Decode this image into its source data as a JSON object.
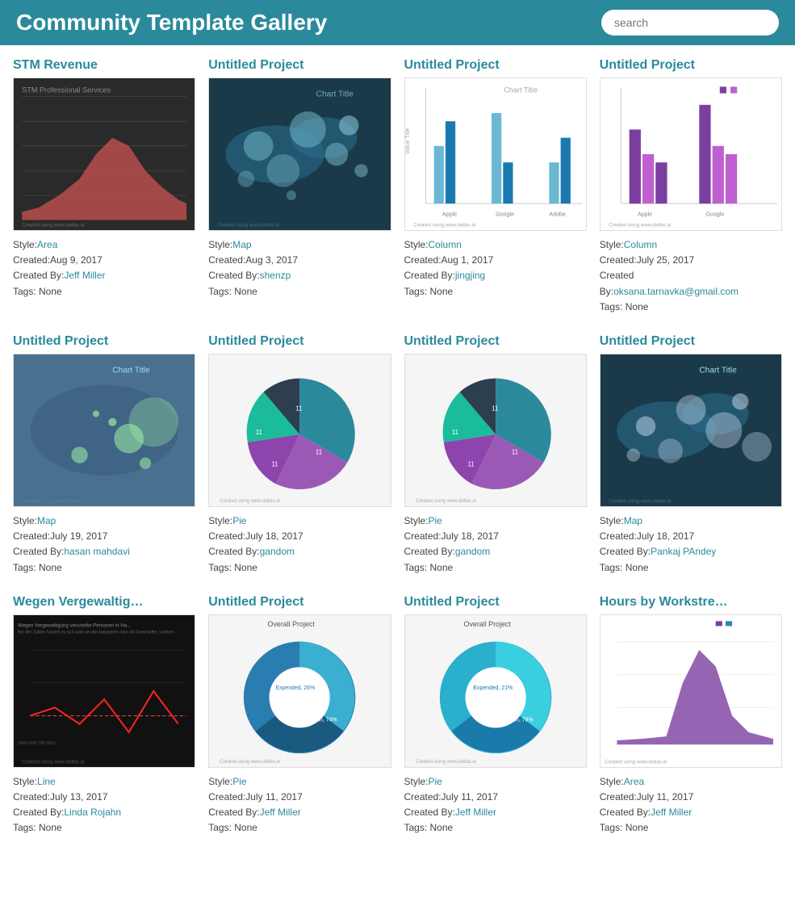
{
  "header": {
    "title": "Community Template Gallery",
    "search_placeholder": "search"
  },
  "cards": [
    {
      "id": "stm-revenue",
      "title": "STM Revenue",
      "style": "Area",
      "created": "Aug 9, 2017",
      "created_by": "Jeff Miller",
      "tags": "None",
      "thumb_type": "area_dark"
    },
    {
      "id": "untitled-1",
      "title": "Untitled Project",
      "style": "Map",
      "created": "Aug 3, 2017",
      "created_by": "shenzp",
      "tags": "None",
      "thumb_type": "map_dark_bubbles"
    },
    {
      "id": "untitled-2",
      "title": "Untitled Project",
      "style": "Column",
      "created": "Aug 1, 2017",
      "created_by": "jingjing",
      "tags": "None",
      "thumb_type": "bar_blue"
    },
    {
      "id": "untitled-3",
      "title": "Untitled Project",
      "style": "Column",
      "created": "July 25, 2017",
      "created_by": "oksana.tarnavka@gmail.com",
      "tags": "None",
      "thumb_type": "bar_purple",
      "created_label_split": true
    },
    {
      "id": "untitled-4",
      "title": "Untitled Project",
      "style": "Map",
      "created": "July 19, 2017",
      "created_by": "hasan mahdavi",
      "tags": "None",
      "thumb_type": "map_green"
    },
    {
      "id": "untitled-5",
      "title": "Untitled Project",
      "style": "Pie",
      "created": "July 18, 2017",
      "created_by": "gandom",
      "tags": "None",
      "thumb_type": "pie1"
    },
    {
      "id": "untitled-6",
      "title": "Untitled Project",
      "style": "Pie",
      "created": "July 18, 2017",
      "created_by": "gandom",
      "tags": "None",
      "thumb_type": "pie2"
    },
    {
      "id": "untitled-7",
      "title": "Untitled Project",
      "style": "Map",
      "created": "July 18, 2017",
      "created_by": "Pankaj PAndey",
      "tags": "None",
      "thumb_type": "map_dark_bubbles2"
    },
    {
      "id": "wegen",
      "title": "Wegen Vergewaltig…",
      "style": "Line",
      "created": "July 13, 2017",
      "created_by": "Linda Rojahn",
      "tags": "None",
      "thumb_type": "line_dark"
    },
    {
      "id": "untitled-8",
      "title": "Untitled Project",
      "style": "Pie",
      "created": "July 11, 2017",
      "created_by": "Jeff Miller",
      "tags": "None",
      "thumb_type": "donut1"
    },
    {
      "id": "untitled-9",
      "title": "Untitled Project",
      "style": "Pie",
      "created": "July 11, 2017",
      "created_by": "Jeff Miller",
      "tags": "None",
      "thumb_type": "donut2"
    },
    {
      "id": "hours",
      "title": "Hours by Workstre…",
      "style": "Area",
      "created": "July 11, 2017",
      "created_by": "Jeff Miller",
      "tags": "None",
      "thumb_type": "area_purple"
    }
  ]
}
